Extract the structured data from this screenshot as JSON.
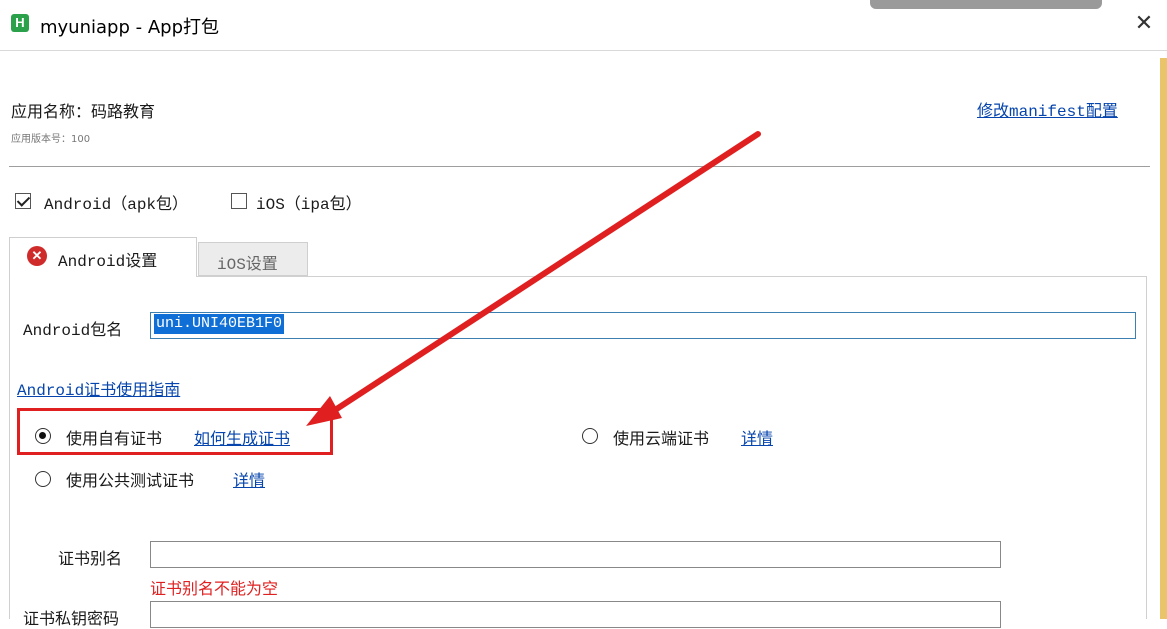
{
  "window": {
    "title": "myuniapp - App打包",
    "close_glyph": "✕",
    "app_icon_glyph": "H"
  },
  "app_info": {
    "name_label": "应用名称：码路教育",
    "version_label": "应用版本号：100",
    "manifest_link": "修改manifest配置"
  },
  "platforms": {
    "android": {
      "label": "Android（apk包）",
      "checked": true
    },
    "ios": {
      "label": "iOS（ipa包）",
      "checked": false
    }
  },
  "tabs": {
    "android": {
      "label": "Android设置",
      "active": true,
      "status_icon": "error-icon",
      "status_glyph": "✕"
    },
    "ios": {
      "label": "iOS设置",
      "active": false
    }
  },
  "form": {
    "package_label": "Android包名",
    "package_value": "uni.UNI40EB1F0",
    "cert_guide_link": "Android证书使用指南",
    "cert_options": [
      {
        "label": "使用自有证书",
        "link": "如何生成证书",
        "selected": true
      },
      {
        "label": "使用云端证书",
        "link": "详情",
        "selected": false
      },
      {
        "label": "使用公共测试证书",
        "link": "详情",
        "selected": false
      }
    ],
    "alias_label": "证书别名",
    "alias_value": "",
    "alias_error": "证书别名不能为空",
    "key_password_label": "证书私钥密码",
    "key_password_value": ""
  },
  "annotation": {
    "arrow_color": "#e02020",
    "box_color": "#e02020"
  }
}
